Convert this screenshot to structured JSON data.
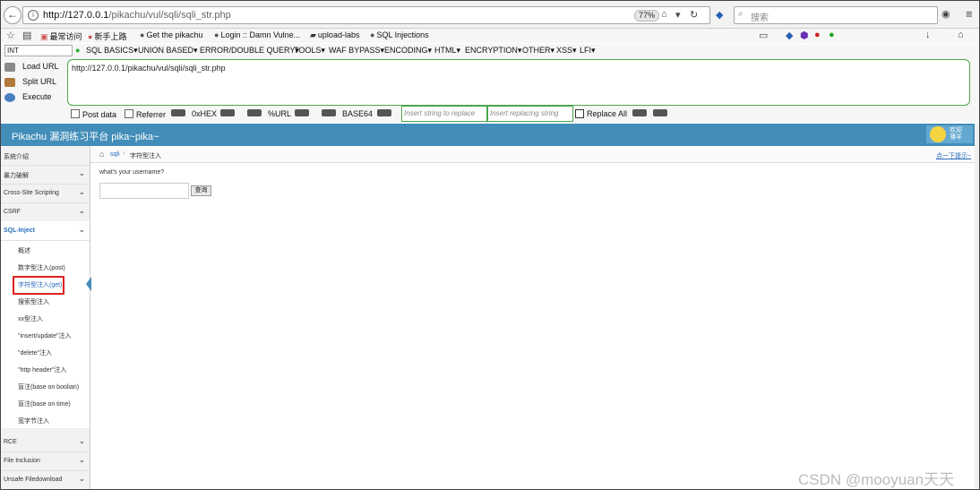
{
  "browser": {
    "url_host": "http://127.0.0.1",
    "url_path": "/pikachu/vul/sqli/sqli_str.php",
    "zoom": "77%",
    "search_placeholder": "搜索"
  },
  "bookmarks": [
    "最常访问",
    "新手上路",
    "Get the pikachu",
    "Login :: Damn Vulne...",
    "upload-labs",
    "SQL Injections"
  ],
  "hackbar": {
    "select_value": "INT",
    "menu": [
      "SQL BASICS▾",
      "UNION BASED▾",
      "ERROR/DOUBLE QUERY▾",
      "TOOLS▾",
      "WAF BYPASS▾",
      "ENCODING▾",
      "HTML▾",
      "ENCRYPTION▾",
      "OTHER▾",
      "XSS▾",
      "LFI▾"
    ],
    "load_url": "Load URL",
    "split_url": "Split URL",
    "execute": "Execute",
    "url_value": "http://127.0.0.1/pikachu/vul/sqli/sqli_str.php",
    "post_data": "Post data",
    "referrer": "Referrer",
    "hex": "0xHEX",
    "urlenc": "%URL",
    "base64": "BASE64",
    "insert_placeholder": "Insert string to replace",
    "replacing_placeholder": "Insert replacing string",
    "replace_all": "Replace All"
  },
  "pikachu": {
    "title": "Pikachu 漏洞练习平台 pika~pika~",
    "welcome": "欢迎\n薄羊"
  },
  "sidebar": {
    "items": [
      "系统介绍",
      "暴力破解",
      "Cross-Site Scripting",
      "CSRF",
      "SQL-Inject"
    ],
    "subitems": [
      "概述",
      "数字型注入(post)",
      "字符型注入(get)",
      "搜索型注入",
      "xx型注入",
      "\"insert/update\"注入",
      "\"delete\"注入",
      "\"http header\"注入",
      "盲注(base on boolian)",
      "盲注(base on time)",
      "宽字节注入"
    ],
    "bottom_items": [
      "RCE",
      "File Inclusion",
      "Unsafe Filedownload"
    ]
  },
  "main": {
    "crumb_1": "sqli",
    "crumb_2": "字符型注入",
    "tip": "点一下提示~",
    "prompt": "what's your username?",
    "submit": "查询"
  },
  "watermark": "CSDN @mooyuan天天"
}
